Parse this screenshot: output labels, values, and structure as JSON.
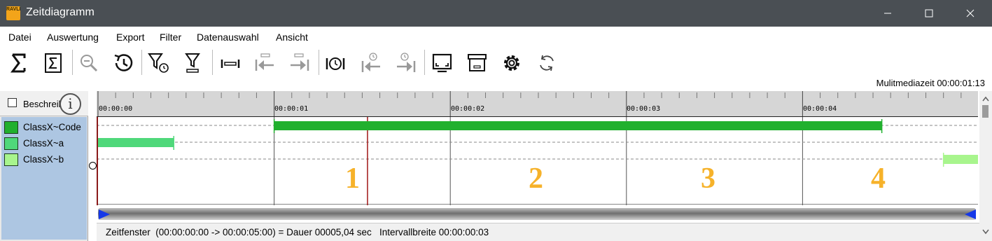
{
  "window": {
    "title": "Zeitdiagramm",
    "icon_text": "RAVLECT",
    "controls": [
      "minimize-icon",
      "maximize-icon",
      "close-icon"
    ]
  },
  "menu": [
    "Datei",
    "Auswertung",
    "Export",
    "Filter",
    "Datenauswahl",
    "Ansicht"
  ],
  "toolbar_icons": [
    "sum-icon",
    "sum-box-icon",
    "zoom-out-icon",
    "history-icon",
    "filter-clock-icon",
    "filter-bar-icon",
    "interval-icon",
    "step-left-icon",
    "step-right-icon",
    "clock-interval-icon",
    "clock-step-left-icon",
    "clock-step-right-icon",
    "screen-icon",
    "archive-icon",
    "gear-icon",
    "refresh-icon"
  ],
  "multimedia_time": "Mulitmediazeit 00:00:01:13",
  "descriptions_checkbox_label": "Beschreibung",
  "info_icon_text": "i",
  "legend": [
    {
      "label": "ClassX~Code",
      "color": "#21b02e"
    },
    {
      "label": "ClassX~a",
      "color": "#4fd87a"
    },
    {
      "label": "ClassX~b",
      "color": "#a8f58d"
    }
  ],
  "ruler_ticks": [
    "00:00:00",
    "00:00:01",
    "00:00:02",
    "00:00:03",
    "00:00:04"
  ],
  "timeline": {
    "start_seconds": 0,
    "end_seconds": 5.0,
    "cursor_seconds": 1.53,
    "series": [
      {
        "name": "ClassX~Code",
        "color": "#21b02e",
        "segments": [
          [
            1.0,
            4.45
          ]
        ]
      },
      {
        "name": "ClassX~a",
        "color": "#4fd87a",
        "segments": [
          [
            0.0,
            0.43
          ]
        ]
      },
      {
        "name": "ClassX~b",
        "color": "#a8f58d",
        "segments": [
          [
            4.8,
            5.0
          ]
        ]
      }
    ]
  },
  "interval_numbers": [
    "1",
    "2",
    "3",
    "4"
  ],
  "status": {
    "text": "Zeitfenster  (00:00:00:00 -> 00:00:05:00) = Dauer 00005,04 sec   Intervallbreite 00:00:00:03"
  }
}
